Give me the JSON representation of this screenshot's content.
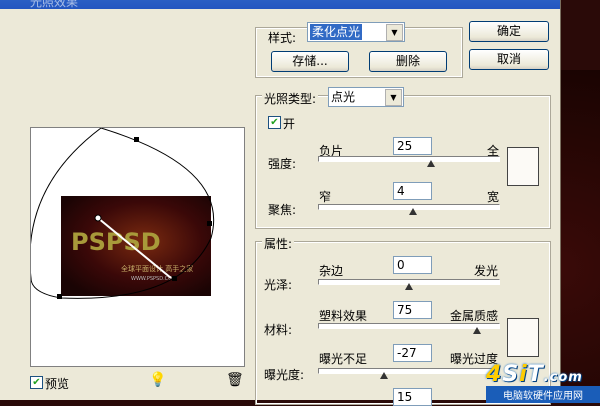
{
  "window": {
    "title": "光照效果"
  },
  "style_section": {
    "style_label": "样式:",
    "style_value": "柔化点光",
    "save_label": "存储...",
    "delete_label": "删除"
  },
  "buttons": {
    "ok_label": "确定",
    "cancel_label": "取消"
  },
  "light_type": {
    "label": "光照类型:",
    "value": "点光",
    "on_label": "开",
    "on_checked": true,
    "intensity": {
      "label": "强度:",
      "min_label": "负片",
      "max_label": "全",
      "value": "25",
      "fraction": 0.62
    },
    "focus": {
      "label": "聚焦:",
      "min_label": "窄",
      "max_label": "宽",
      "value": "4",
      "fraction": 0.52
    }
  },
  "properties": {
    "title": "属性:",
    "gloss": {
      "label": "光泽:",
      "min_label": "杂边",
      "max_label": "发光",
      "value": "0",
      "fraction": 0.5
    },
    "material": {
      "label": "材料:",
      "min_label": "塑料效果",
      "max_label": "金属质感",
      "value": "75",
      "fraction": 0.88
    },
    "exposure": {
      "label": "曝光度:",
      "min_label": "曝光不足",
      "max_label": "曝光过度",
      "value": "-27",
      "fraction": 0.36
    },
    "ambience": {
      "value": "15"
    }
  },
  "preview": {
    "checkbox_label": "预览",
    "checked": true,
    "image_text_main": "PSPSD",
    "image_text_sub": "全球平面设计 高手之家",
    "image_text_url": "WWW.PSPSD.COM"
  },
  "watermark": {
    "logo_a": "4",
    "logo_b": "S",
    "logo_c": "i",
    "logo_d": "T",
    "logo_com": ".com",
    "subtitle": "电脑软硬件应用网"
  },
  "colors": {
    "light_swatch": "#fcfaf6",
    "material_swatch": "#fcfaf6"
  }
}
